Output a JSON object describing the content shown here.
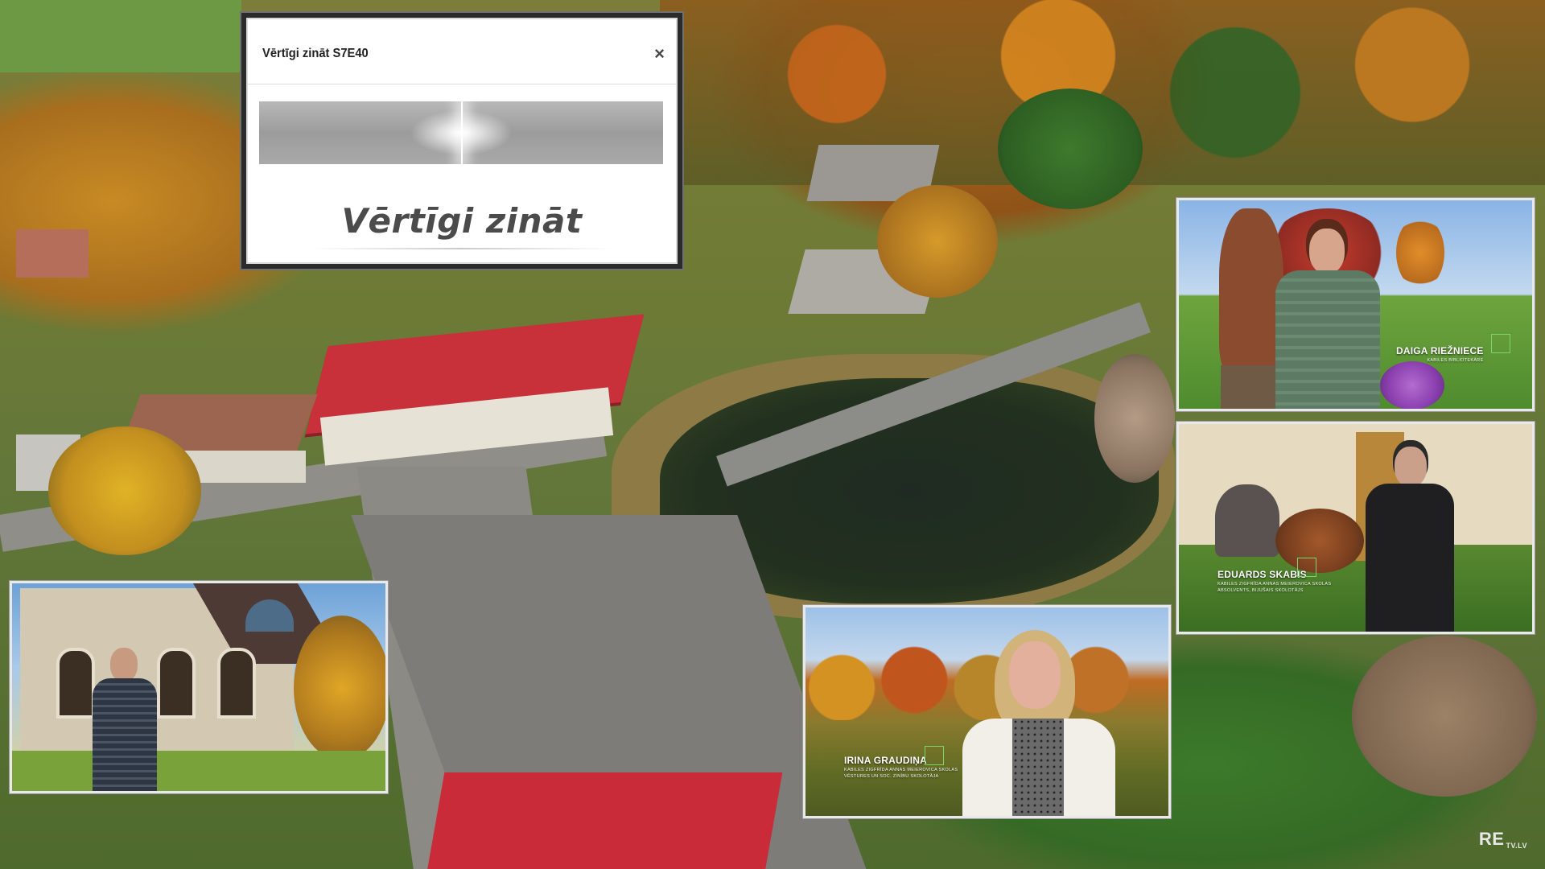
{
  "popup": {
    "title": "Vērtīgi zināt S7E40",
    "close_glyph": "×",
    "logo_text": "Vērtīgi zināt"
  },
  "clips": {
    "daiga": {
      "name": "DAIGA RIEŽNIECE",
      "role": "KABILES BIBLIOTEKĀRE"
    },
    "eduards": {
      "name": "EDUARDS SKABIS",
      "role_line1": "KABILES ZIGFRĪDA ANNAS MEIEROVICA SKOLAS",
      "role_line2": "ABSOLVENTS, BIJUŠAIS SKOLOTĀJS"
    },
    "irina": {
      "name": "IRINA GRAUDIŅA",
      "role_line1": "KABILES ZIGFRĪDA ANNAS MEIEROVICA SKOLAS",
      "role_line2": "VĒSTURES UN SOC. ZINĪBU SKOLOTĀJA"
    }
  },
  "watermark": {
    "brand": "RE",
    "suffix": "TV.LV"
  },
  "colors": {
    "lower_third_accent": "#7cd46a",
    "roof_red": "#c8303a"
  }
}
